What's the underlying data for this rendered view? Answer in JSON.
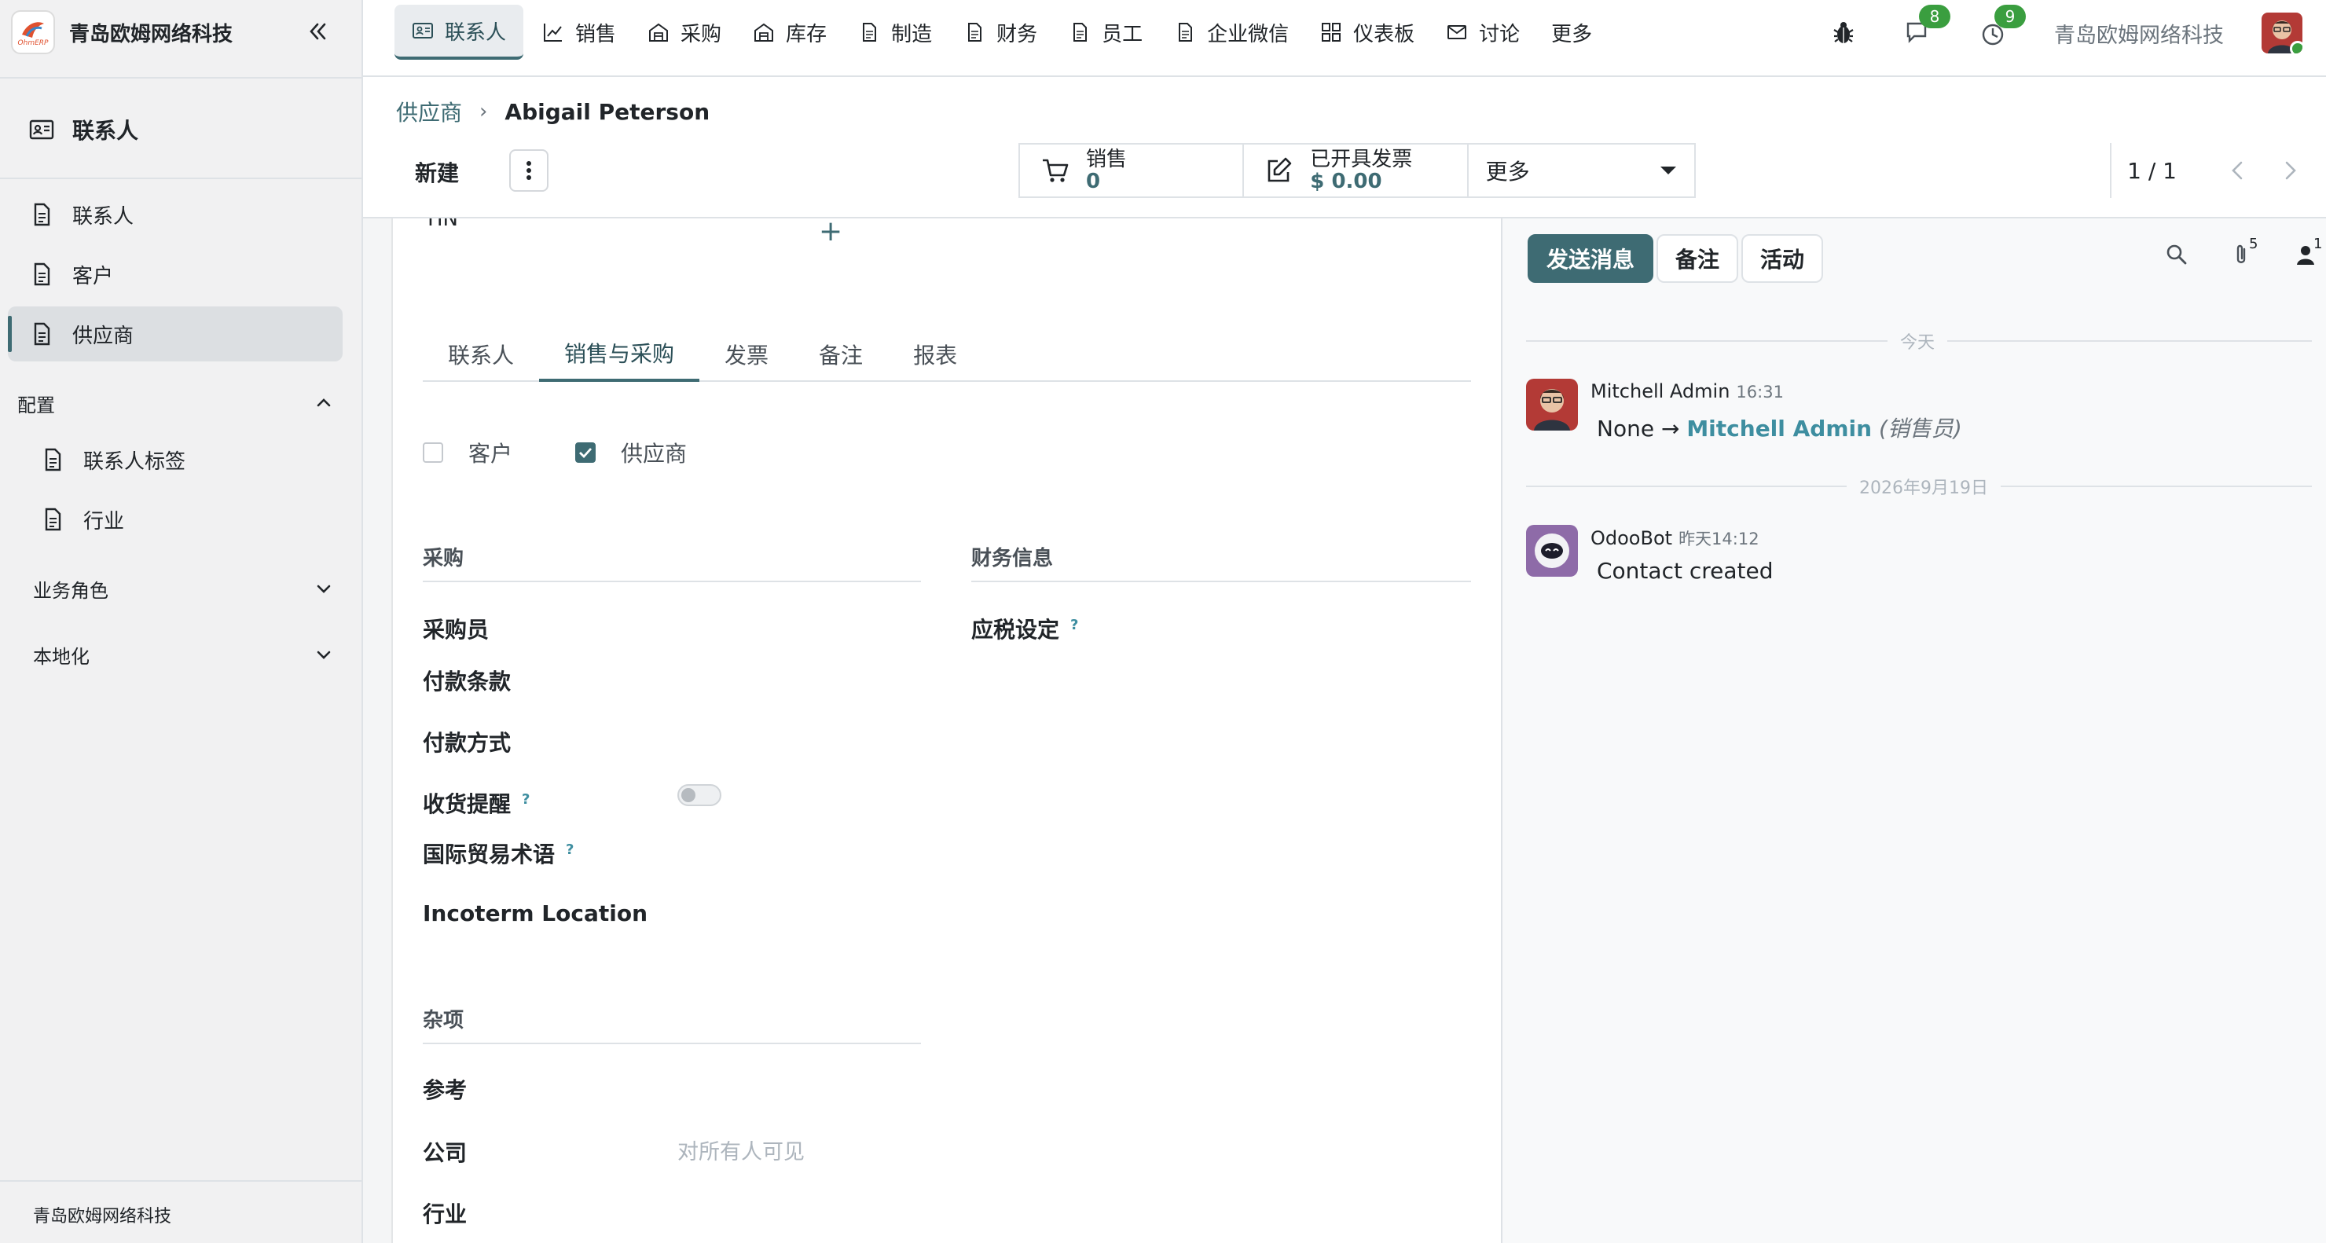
{
  "sidebar": {
    "brand": "青岛欧姆网络科技",
    "logo_text": "OhmERP",
    "app": "联系人",
    "items": [
      {
        "label": "联系人"
      },
      {
        "label": "客户"
      },
      {
        "label": "供应商"
      }
    ],
    "config_label": "配置",
    "config_items": [
      {
        "label": "联系人标签"
      },
      {
        "label": "行业"
      }
    ],
    "roles_label": "业务角色",
    "localization_label": "本地化",
    "footer": "青岛欧姆网络科技"
  },
  "topnav": {
    "menu": [
      {
        "label": "联系人",
        "icon": "contact-card-icon"
      },
      {
        "label": "销售",
        "icon": "chart-line-icon"
      },
      {
        "label": "采购",
        "icon": "building-icon"
      },
      {
        "label": "库存",
        "icon": "building-icon"
      },
      {
        "label": "制造",
        "icon": "document-icon"
      },
      {
        "label": "财务",
        "icon": "document-icon"
      },
      {
        "label": "员工",
        "icon": "document-icon"
      },
      {
        "label": "企业微信",
        "icon": "document-icon"
      },
      {
        "label": "仪表板",
        "icon": "grid-icon"
      },
      {
        "label": "讨论",
        "icon": "envelope-icon"
      },
      {
        "label": "更多",
        "icon": ""
      }
    ],
    "messages_count": "8",
    "activities_count": "9",
    "company": "青岛欧姆网络科技"
  },
  "control": {
    "breadcrumb_parent": "供应商",
    "breadcrumb_current": "Abigail Peterson",
    "new_label": "新建",
    "smart_buttons": [
      {
        "label": "销售",
        "value": "0"
      },
      {
        "label": "已开具发票",
        "value": "$ 0.00"
      }
    ],
    "more_label": "更多",
    "pager": "1 / 1"
  },
  "form": {
    "tin_fragment": "TIN",
    "tabs": [
      "联系人",
      "销售与采购",
      "发票",
      "备注",
      "报表"
    ],
    "active_tab": "销售与采购",
    "customer_label": "客户",
    "customer_checked": false,
    "supplier_label": "供应商",
    "supplier_checked": true,
    "purchase_title": "采购",
    "finance_title": "财务信息",
    "fields": {
      "buyer": "采购员",
      "payment_terms": "付款条款",
      "payment_method": "付款方式",
      "receipt_reminder": "收货提醒",
      "incoterms": "国际贸易术语",
      "incoterm_location": "Incoterm Location",
      "fiscal_position": "应税设定"
    },
    "help_mark": "?",
    "misc_title": "杂项",
    "ref_label": "参考",
    "company_label": "公司",
    "company_placeholder": "对所有人可见",
    "industry_label": "行业"
  },
  "chatter": {
    "send_message": "发送消息",
    "log_note": "备注",
    "activities": "活动",
    "attachments_count": "5",
    "followers_count": "1",
    "today_label": "今天",
    "date_label": "2026年9月19日",
    "messages": [
      {
        "author": "Mitchell Admin",
        "time": "16:31",
        "before": "None → ",
        "link": "Mitchell Admin",
        "note": "(销售员)"
      },
      {
        "author": "OdooBot",
        "time": "昨天14:12",
        "body": "Contact created"
      }
    ]
  },
  "colors": {
    "accent": "#3e6b73",
    "badge": "#3a9e3f",
    "sidebar_bg": "#f1f1f2"
  }
}
